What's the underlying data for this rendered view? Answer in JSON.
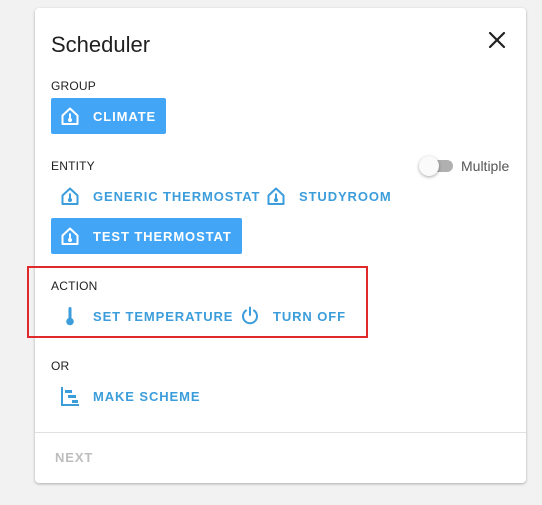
{
  "dialog": {
    "title": "Scheduler",
    "close_icon": "close-icon"
  },
  "group": {
    "label": "GROUP",
    "items": [
      {
        "label": "CLIMATE",
        "icon": "home-thermometer-icon",
        "selected": true
      }
    ]
  },
  "entity": {
    "label": "ENTITY",
    "multiple_label": "Multiple",
    "multiple_enabled": false,
    "items": [
      {
        "label": "GENERIC THERMOSTAT",
        "icon": "home-thermometer-icon",
        "selected": false
      },
      {
        "label": "STUDYROOM",
        "icon": "home-thermometer-icon",
        "selected": false
      },
      {
        "label": "TEST THERMOSTAT",
        "icon": "home-thermometer-icon",
        "selected": true
      }
    ]
  },
  "action": {
    "label": "ACTION",
    "items": [
      {
        "label": "SET TEMPERATURE",
        "icon": "thermometer-icon"
      },
      {
        "label": "TURN OFF",
        "icon": "power-icon"
      }
    ]
  },
  "or": {
    "label": "OR",
    "items": [
      {
        "label": "MAKE SCHEME",
        "icon": "chart-gantt-icon"
      }
    ]
  },
  "footer": {
    "next_label": "NEXT",
    "next_enabled": false
  },
  "colors": {
    "accent": "#42a5f5",
    "link": "#3c9ddb",
    "highlight_box": "#e02a2a"
  }
}
